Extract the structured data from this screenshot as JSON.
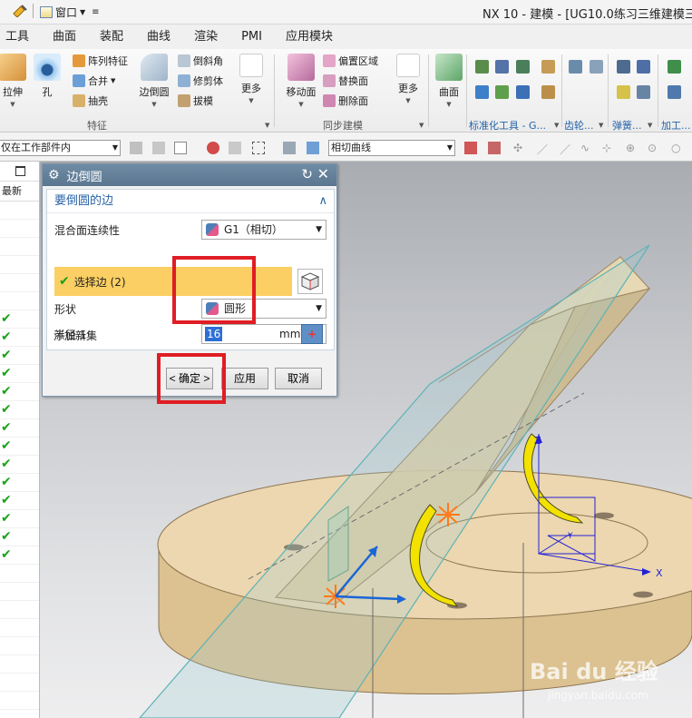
{
  "titlebar": {
    "window_menu": "窗口",
    "title": "NX 10 - 建模 - [UG10.0练习三维建模三十八"
  },
  "menubar": {
    "items": [
      "工具",
      "曲面",
      "装配",
      "曲线",
      "渲染",
      "PMI",
      "应用模块"
    ]
  },
  "ribbon": {
    "extrude": "拉伸",
    "hole": "孔",
    "pattern_feature": "阵列特征",
    "unite": "合并",
    "shell": "抽壳",
    "edge_blend": "边倒圆",
    "chamfer": "倒斜角",
    "trim_body": "修剪体",
    "draft": "拔模",
    "more1": "更多",
    "feature_group": "特征",
    "move_face": "移动面",
    "offset_region": "偏置区域",
    "replace_face": "替换面",
    "delete_face": "删除面",
    "more2": "更多",
    "sync_group": "同步建模",
    "surface": "曲面",
    "std_parts_group": "标准化工具 - G...",
    "gear_group": "齿轮...",
    "spring_group": "弹簧...",
    "machining_group": "加工..."
  },
  "filterbar": {
    "scope": "仅在工作部件内",
    "curve_rule": "相切曲线"
  },
  "navigator": {
    "column_header": "最新",
    "checked_rows": 14
  },
  "dialog": {
    "title": "边倒圆",
    "group_title": "要倒圆的边",
    "continuity_label": "混合面连续性",
    "continuity_value": "G1（相切）",
    "select_edge": "选择边 (2)",
    "shape_label": "形状",
    "shape_value": "圆形",
    "radius_label": "半径 1",
    "radius_value": "16",
    "radius_unit": "mm",
    "add_new_set": "添加新集",
    "ok": "< 确定 >",
    "apply": "应用",
    "cancel": "取消"
  },
  "viewport": {
    "axis_x": "X",
    "axis_y": "Y",
    "axis_z": "Z",
    "watermark_brand": "Bai du 经验",
    "watermark_url": "jingyan.baidu.com"
  },
  "colors": {
    "highlight": "#fbcf63",
    "dialog_title": "#5f7b95",
    "callout": "#e01d24",
    "part_body": "#e8cfa3",
    "fillet_preview": "#f3e100"
  }
}
